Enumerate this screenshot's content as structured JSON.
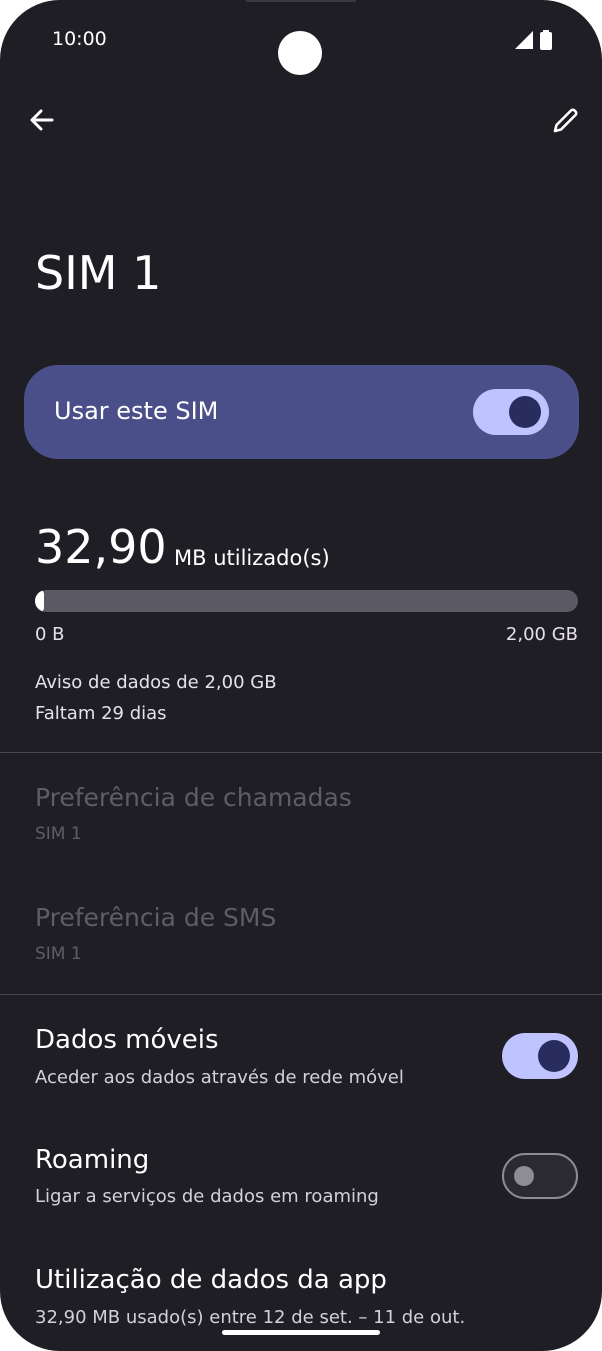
{
  "status_bar": {
    "time": "10:00"
  },
  "page": {
    "title": "SIM 1"
  },
  "sim_toggle": {
    "label": "Usar este SIM",
    "state": "on"
  },
  "usage": {
    "amount": "32,90",
    "unit_label": "MB utilizado(s)",
    "progress_fraction": 0.016,
    "range_min": "0 B",
    "range_max": "2,00 GB",
    "warning": "Aviso de dados de 2,00 GB",
    "remaining": "Faltam 29 dias"
  },
  "preferences": [
    {
      "title": "Preferência de chamadas",
      "value": "SIM 1",
      "enabled": false
    },
    {
      "title": "Preferência de SMS",
      "value": "SIM 1",
      "enabled": false
    }
  ],
  "settings": [
    {
      "title": "Dados móveis",
      "subtitle": "Aceder aos dados através de rede móvel",
      "toggle": "on"
    },
    {
      "title": "Roaming",
      "subtitle": "Ligar a serviços de dados em roaming",
      "toggle": "off"
    },
    {
      "title": "Utilização de dados da app",
      "subtitle": "32,90 MB usado(s) entre 12 de set. – 11 de out."
    }
  ],
  "icons": {
    "back": "arrow-back-icon",
    "edit": "pencil-icon",
    "signal": "signal-icon",
    "battery": "battery-icon"
  },
  "colors": {
    "background": "#1f1e24",
    "accent_card": "#4a4f8a",
    "toggle_on": "#bfc3ff"
  }
}
